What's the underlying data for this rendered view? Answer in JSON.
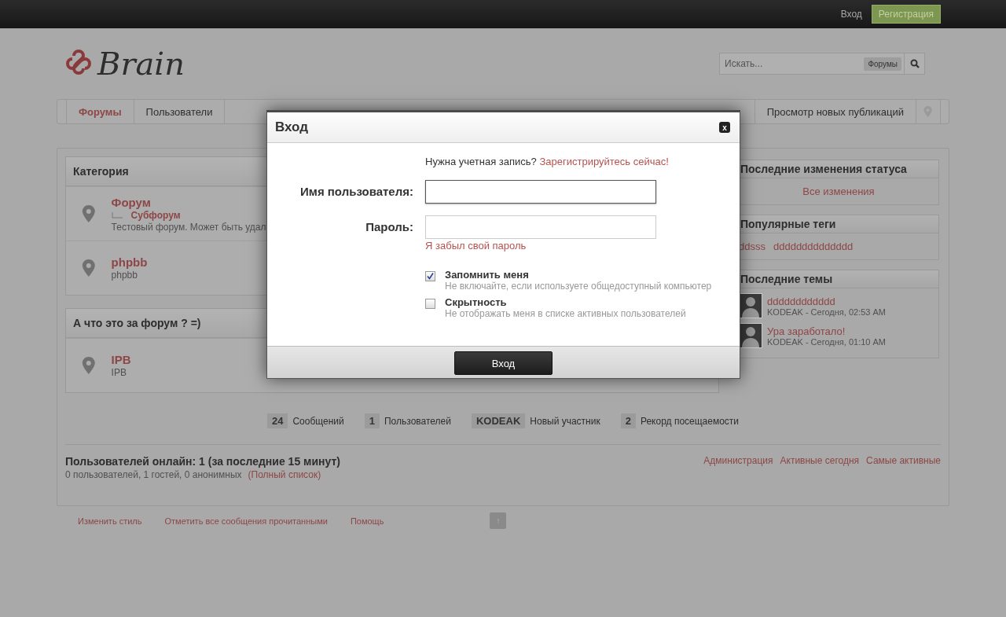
{
  "top_bar": {
    "login": "Вход",
    "register": "Регистрация"
  },
  "logo": {
    "text": "Brain"
  },
  "search": {
    "placeholder": "Искать...",
    "scope": "Форумы"
  },
  "nav": {
    "tabs": [
      {
        "label": "Форумы",
        "selected": true
      },
      {
        "label": "Пользователи",
        "selected": false
      }
    ],
    "right_link": "Просмотр новых публикаций"
  },
  "categories": [
    {
      "title": "Категория",
      "forums": [
        {
          "name": "Форум",
          "subforum": "Субфорум",
          "description": "Тестовый форум. Может быть удал"
        },
        {
          "name": "phpbb",
          "description": "phpbb"
        }
      ]
    },
    {
      "title": "А что это за форум ? =)",
      "forums": [
        {
          "name": "IPB",
          "description": "IPB"
        }
      ]
    }
  ],
  "sidebar": {
    "status": {
      "title": "Последние изменения статуса",
      "link": "Все изменения"
    },
    "tags": {
      "title": "Популярные теги",
      "items": [
        "ddsss",
        "dddddddddddddd"
      ]
    },
    "topics": {
      "title": "Последние темы",
      "items": [
        {
          "title": "dddddddddddd",
          "meta": "KODEAK - Сегодня, 02:53 AM"
        },
        {
          "title": "Ура заработало!",
          "meta": "KODEAK - Сегодня, 01:10 AM"
        }
      ]
    }
  },
  "stats": [
    {
      "value": "24",
      "label": "Сообщений"
    },
    {
      "value": "1",
      "label": "Пользователей"
    },
    {
      "value": "KODEAK",
      "label": "Новый участник"
    },
    {
      "value": "2",
      "label": "Рекорд посещаемости"
    }
  ],
  "online": {
    "title": "Пользователей онлайн: 1 (за последние 15 минут)",
    "summary": "0 пользователей, 1 гостей, 0 анонимных",
    "full_list": "(Полный список)",
    "links": [
      "Администрация",
      "Активные сегодня",
      "Самые активные"
    ]
  },
  "footer": {
    "links": [
      "Изменить стиль",
      "Отметить все сообщения прочитанными",
      "Помощь"
    ],
    "top_button": "↑"
  },
  "dialog": {
    "title": "Вход",
    "close": "x",
    "prompt": "Нужна учетная запись?",
    "register_link": "Зарегистрируйтесь сейчас!",
    "username_label": "Имя пользователя:",
    "password_label": "Пароль:",
    "forgot": "Я забыл свой пароль",
    "options": [
      {
        "label": "Запомнить меня",
        "hint": "Не включайте, если используете общедоступный компьютер",
        "checked": true
      },
      {
        "label": "Скрытность",
        "hint": "Не отображать меня в списке активных пользователей",
        "checked": false
      }
    ],
    "submit": "Вход"
  }
}
